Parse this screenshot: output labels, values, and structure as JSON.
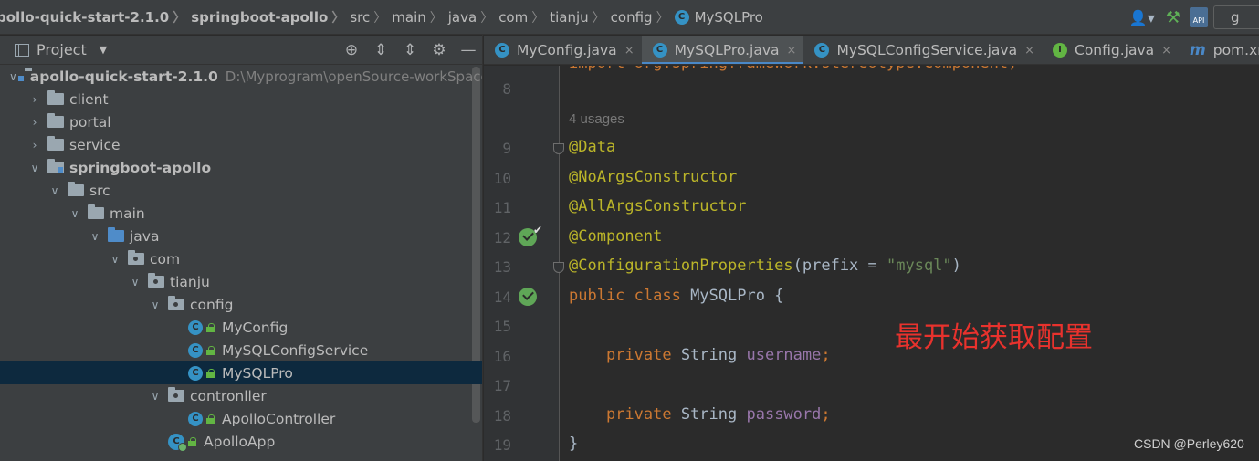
{
  "breadcrumb": [
    {
      "label": "pollo-quick-start-2.1.0",
      "bold": true
    },
    {
      "label": "springboot-apollo",
      "bold": true
    },
    {
      "label": "src"
    },
    {
      "label": "main"
    },
    {
      "label": "java"
    },
    {
      "label": "com"
    },
    {
      "label": "tianju"
    },
    {
      "label": "config"
    },
    {
      "label": "MySQLPro",
      "icon": "class"
    }
  ],
  "toolbar": {
    "run_config_label": "g",
    "api_label": "API"
  },
  "project_panel": {
    "title": "Project"
  },
  "tree": [
    {
      "label": "apollo-quick-start-2.1.0",
      "path": "D:\\Myprogram\\openSource-workSpace",
      "level": 0,
      "arrow": "open",
      "kind": "module",
      "bold": true
    },
    {
      "label": "client",
      "level": 1,
      "arrow": "closed",
      "kind": "folder"
    },
    {
      "label": "portal",
      "level": 1,
      "arrow": "closed",
      "kind": "folder"
    },
    {
      "label": "service",
      "level": 1,
      "arrow": "closed",
      "kind": "folder"
    },
    {
      "label": "springboot-apollo",
      "level": 1,
      "arrow": "open",
      "kind": "module",
      "bold": true
    },
    {
      "label": "src",
      "level": 2,
      "arrow": "open",
      "kind": "folder"
    },
    {
      "label": "main",
      "level": 3,
      "arrow": "open",
      "kind": "folder"
    },
    {
      "label": "java",
      "level": 4,
      "arrow": "open",
      "kind": "source"
    },
    {
      "label": "com",
      "level": 5,
      "arrow": "open",
      "kind": "package"
    },
    {
      "label": "tianju",
      "level": 6,
      "arrow": "open",
      "kind": "package"
    },
    {
      "label": "config",
      "level": 7,
      "arrow": "open",
      "kind": "package"
    },
    {
      "label": "MyConfig",
      "level": 8,
      "arrow": "none",
      "kind": "class"
    },
    {
      "label": "MySQLConfigService",
      "level": 8,
      "arrow": "none",
      "kind": "class"
    },
    {
      "label": "MySQLPro",
      "level": 8,
      "arrow": "none",
      "kind": "class",
      "selected": true
    },
    {
      "label": "contronller",
      "level": 7,
      "arrow": "open",
      "kind": "package"
    },
    {
      "label": "ApolloController",
      "level": 8,
      "arrow": "none",
      "kind": "class"
    },
    {
      "label": "ApolloApp",
      "level": 7,
      "arrow": "none",
      "kind": "bootclass"
    }
  ],
  "tabs": [
    {
      "label": "MyConfig.java",
      "icon": "class"
    },
    {
      "label": "MySQLPro.java",
      "icon": "class",
      "active": true
    },
    {
      "label": "MySQLConfigService.java",
      "icon": "class"
    },
    {
      "label": "Config.java",
      "icon": "interface"
    },
    {
      "label": "pom.xml (s",
      "icon": "maven"
    }
  ],
  "editor": {
    "top_partial": [
      {
        "t": "import org.springframework.stereotype.Component;",
        "c": "kw"
      }
    ],
    "usages_hint": "4 usages",
    "lines": [
      {
        "n": "8",
        "parts": []
      },
      {
        "n": "9",
        "parts": [
          {
            "t": "@Data",
            "c": "ann"
          }
        ],
        "fold": true
      },
      {
        "n": "10",
        "parts": [
          {
            "t": "@NoArgsConstructor",
            "c": "ann"
          }
        ]
      },
      {
        "n": "11",
        "parts": [
          {
            "t": "@AllArgsConstructor",
            "c": "ann"
          }
        ]
      },
      {
        "n": "12",
        "parts": [
          {
            "t": "@Component",
            "c": "ann"
          }
        ],
        "bean": "check"
      },
      {
        "n": "13",
        "parts": [
          {
            "t": "@ConfigurationProperties",
            "c": "ann"
          },
          {
            "t": "(prefix = ",
            "c": ""
          },
          {
            "t": "\"mysql\"",
            "c": "str"
          },
          {
            "t": ")",
            "c": ""
          }
        ],
        "fold": true
      },
      {
        "n": "14",
        "parts": [
          {
            "t": "public class ",
            "c": "kw"
          },
          {
            "t": "MySQLPro {",
            "c": ""
          }
        ],
        "bean": "plain"
      },
      {
        "n": "15",
        "parts": []
      },
      {
        "n": "16",
        "parts": [
          {
            "t": "    private ",
            "c": "kw"
          },
          {
            "t": "String ",
            "c": ""
          },
          {
            "t": "username",
            "c": "fld"
          },
          {
            "t": ";",
            "c": "kw"
          }
        ]
      },
      {
        "n": "17",
        "parts": []
      },
      {
        "n": "18",
        "parts": [
          {
            "t": "    private ",
            "c": "kw"
          },
          {
            "t": "String ",
            "c": ""
          },
          {
            "t": "password",
            "c": "fld"
          },
          {
            "t": ";",
            "c": "kw"
          }
        ]
      },
      {
        "n": "19",
        "parts": [
          {
            "t": "}",
            "c": ""
          }
        ]
      }
    ]
  },
  "overlay_text": "最开始获取配置",
  "watermark": "CSDN @Perley620",
  "colors": {
    "annotation": "#bbb529",
    "keyword": "#cc7832",
    "string": "#6a8759",
    "field": "#9876aa",
    "overlay": "#e8322d",
    "selection": "#0d293e",
    "accent": "#4a88c7"
  }
}
